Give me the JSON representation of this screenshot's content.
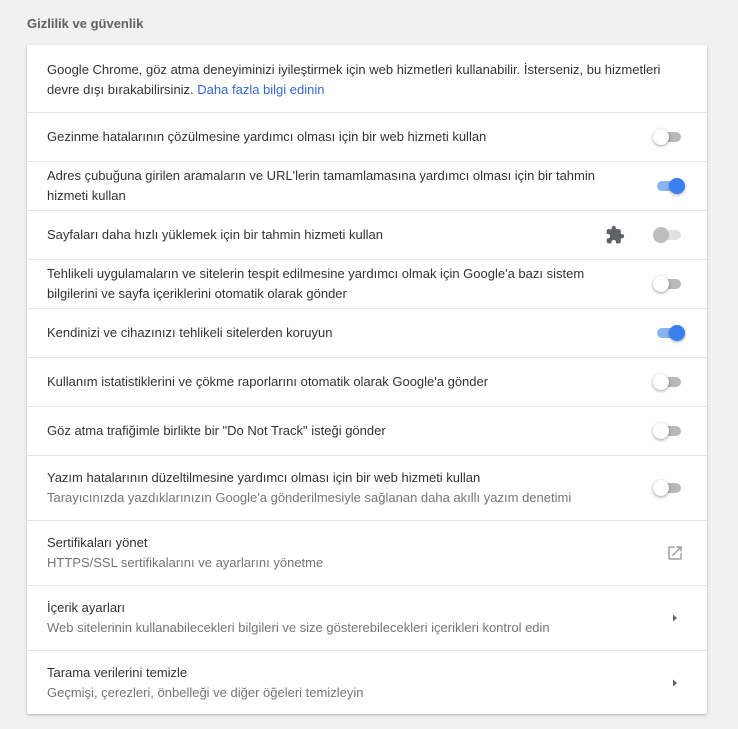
{
  "section": {
    "title": "Gizlilik ve güvenlik"
  },
  "intro": {
    "text": "Google Chrome, göz atma deneyiminizi iyileştirmek için web hizmetleri kullanabilir. İsterseniz, bu hizmetleri devre dışı bırakabilirsiniz. ",
    "link": "Daha fazla bilgi edinin"
  },
  "settings": [
    {
      "label": "Gezinme hatalarının çözülmesine yardımcı olması için bir web hizmeti kullan",
      "enabled": false
    },
    {
      "label": "Adres çubuğuna girilen aramaların ve URL'lerin tamamlamasına yardımcı olması için bir tahmin hizmeti kullan",
      "enabled": true
    },
    {
      "label": "Sayfaları daha hızlı yüklemek için bir tahmin hizmeti kullan",
      "enabled": false,
      "disabled": true,
      "icon": "extension-puzzle-icon"
    },
    {
      "label": "Tehlikeli uygulamaların ve sitelerin tespit edilmesine yardımcı olmak için Google'a bazı sistem bilgilerini ve sayfa içeriklerini otomatik olarak gönder",
      "enabled": false
    },
    {
      "label": "Kendinizi ve cihazınızı tehlikeli sitelerden koruyun",
      "enabled": true
    },
    {
      "label": "Kullanım istatistiklerini ve çökme raporlarını otomatik olarak Google'a gönder",
      "enabled": false
    },
    {
      "label": "Göz atma trafiğimle birlikte bir \"Do Not Track\" isteği gönder",
      "enabled": false
    },
    {
      "label": "Yazım hatalarının düzeltilmesine yardımcı olması için bir web hizmeti kullan",
      "sublabel": "Tarayıcınızda yazdıklarınızın Google'a gönderilmesiyle sağlanan daha akıllı yazım denetimi",
      "enabled": false
    }
  ],
  "links": [
    {
      "label": "Sertifikaları yönet",
      "sublabel": "HTTPS/SSL sertifikalarını ve ayarlarını yönetme",
      "icon": "open-in-new-icon"
    },
    {
      "label": "İçerik ayarları",
      "sublabel": "Web sitelerinin kullanabilecekleri bilgileri ve size gösterebilecekleri içerikleri kontrol edin",
      "icon": "chevron-right-icon"
    },
    {
      "label": "Tarama verilerini temizle",
      "sublabel": "Geçmişi, çerezleri, önbelleği ve diğer öğeleri temizleyin",
      "icon": "chevron-right-icon"
    }
  ],
  "colors": {
    "toggle_on_knob": "#3a7ff0",
    "toggle_on_track": "#8ab4f0",
    "link": "#3367d6"
  }
}
